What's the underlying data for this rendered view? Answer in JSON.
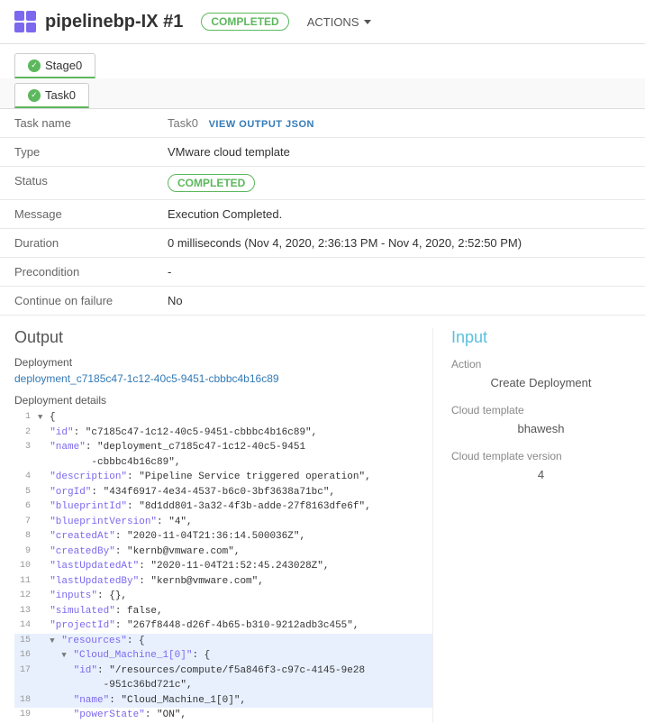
{
  "header": {
    "icon_label": "pipeline-icon",
    "title": "pipelinebp-IX #1",
    "badge": "COMPLETED",
    "actions_label": "ACTIONS"
  },
  "stage_tab": {
    "label": "Stage0"
  },
  "task_tab": {
    "label": "Task0"
  },
  "details": {
    "rows": [
      {
        "label": "Task name",
        "value": "Task0",
        "extra": "VIEW OUTPUT JSON"
      },
      {
        "label": "Type",
        "value": "VMware cloud template"
      },
      {
        "label": "Status",
        "value": "COMPLETED",
        "type": "badge"
      },
      {
        "label": "Message",
        "value": "Execution Completed."
      },
      {
        "label": "Duration",
        "value": "0 milliseconds (Nov 4, 2020, 2:36:13 PM - Nov 4, 2020, 2:52:50 PM)"
      },
      {
        "label": "Precondition",
        "value": "-"
      },
      {
        "label": "Continue on failure",
        "value": "No"
      }
    ]
  },
  "output": {
    "title": "Output",
    "deployment_label": "Deployment",
    "deployment_id": "deployment_c7185c47-1c12-40c5-9451-cbbbc4b16c89",
    "deployment_details_label": "Deployment details",
    "code_lines": [
      {
        "num": "1",
        "content": "{",
        "highlighted": false
      },
      {
        "num": "2",
        "content": "  \"id\": \"c7185c47-1c12-40c5-9451-cbbbc4b16c89\",",
        "highlighted": false
      },
      {
        "num": "3",
        "content": "  \"name\": \"deployment_c7185c47-1c12-40c5-9451\n         -cbbbc4b16c89\",",
        "highlighted": false
      },
      {
        "num": "4",
        "content": "  \"description\": \"Pipeline Service triggered operation\",",
        "highlighted": false
      },
      {
        "num": "5",
        "content": "  \"orgId\": \"434f6917-4e34-4537-b6c0-3bf3638a71bc\",",
        "highlighted": false
      },
      {
        "num": "6",
        "content": "  \"blueprintId\": \"8d1dd801-3a32-4f3b-adde-27f8163dfe6f\",",
        "highlighted": false
      },
      {
        "num": "7",
        "content": "  \"blueprintVersion\": \"4\",",
        "highlighted": false
      },
      {
        "num": "8",
        "content": "  \"createdAt\": \"2020-11-04T21:36:14.500036Z\",",
        "highlighted": false
      },
      {
        "num": "9",
        "content": "  \"createdBy\": \"kernb@vmware.com\",",
        "highlighted": false
      },
      {
        "num": "10",
        "content": "  \"lastUpdatedAt\": \"2020-11-04T21:52:45.243028Z\",",
        "highlighted": false
      },
      {
        "num": "11",
        "content": "  \"lastUpdatedBy\": \"kernb@vmware.com\",",
        "highlighted": false
      },
      {
        "num": "12",
        "content": "  \"inputs\": {},",
        "highlighted": false
      },
      {
        "num": "13",
        "content": "  \"simulated\": false,",
        "highlighted": false
      },
      {
        "num": "14",
        "content": "  \"projectId\": \"267f8448-d26f-4b65-b310-9212adb3c455\",",
        "highlighted": false
      },
      {
        "num": "15",
        "content": "  \"resources\": {",
        "highlighted": true
      },
      {
        "num": "16",
        "content": "    \"Cloud_Machine_1[0]\": {",
        "highlighted": true
      },
      {
        "num": "17",
        "content": "      \"id\": \"/resources/compute/f5a846f3-c97c-4145-9e28\n           -951c36bd721c\",",
        "highlighted": true
      },
      {
        "num": "18",
        "content": "      \"name\": \"Cloud_Machine_1[0]\",",
        "highlighted": true
      },
      {
        "num": "19",
        "content": "      \"powerState\": \"ON\",",
        "highlighted": false
      }
    ]
  },
  "input": {
    "title": "Input",
    "action_label": "Action",
    "action_value": "Create Deployment",
    "cloud_template_label": "Cloud template",
    "cloud_template_value": "bhawesh",
    "cloud_template_version_label": "Cloud template version",
    "cloud_template_version_value": "4"
  }
}
